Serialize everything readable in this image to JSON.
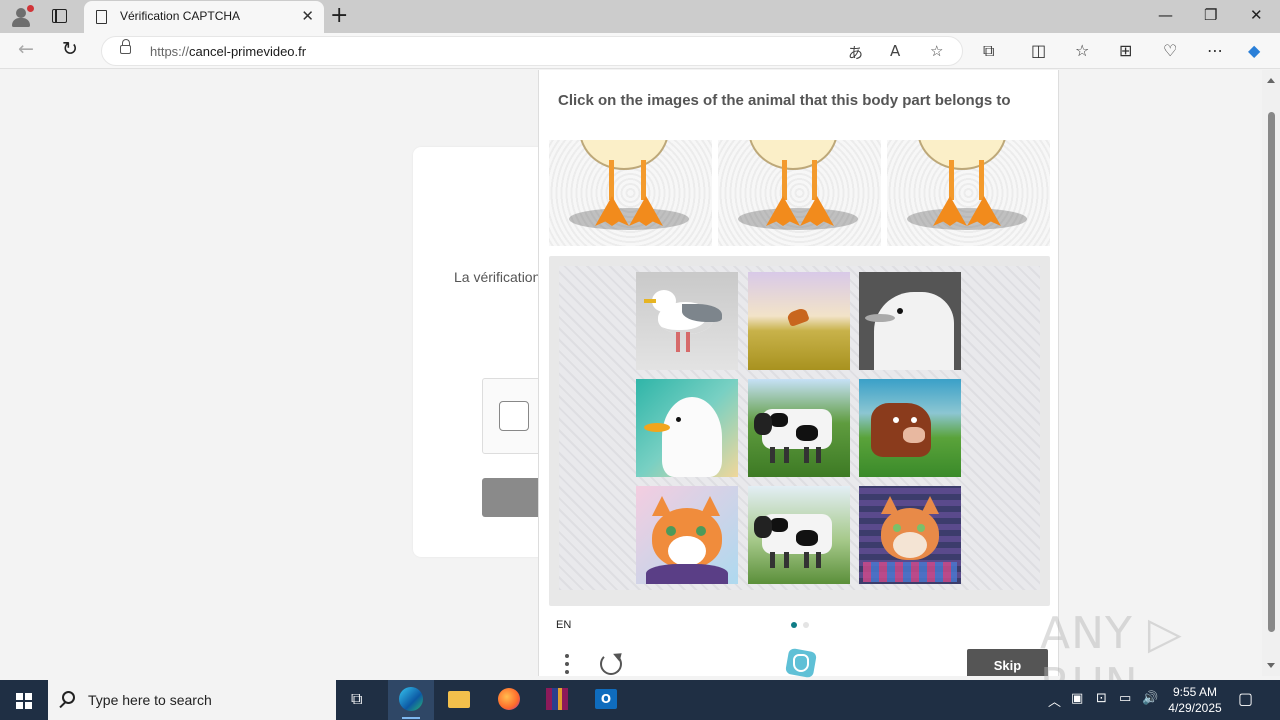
{
  "browser": {
    "tab_title": "Vérification CAPTCHA",
    "url_proto": "https://",
    "url_host": "cancel-primevideo.fr"
  },
  "page": {
    "verification_text": "La vérification"
  },
  "captcha": {
    "instruction": "Click on the images of the animal that this body part belongs to",
    "language": "EN",
    "skip_label": "Skip",
    "page_count": 2,
    "current_page": 1,
    "grid_tiles": [
      {
        "subject": "seagull"
      },
      {
        "subject": "cat in field"
      },
      {
        "subject": "seagull head"
      },
      {
        "subject": "seagull"
      },
      {
        "subject": "cow"
      },
      {
        "subject": "brown cow"
      },
      {
        "subject": "orange cat"
      },
      {
        "subject": "cow"
      },
      {
        "subject": "cat mosaic"
      }
    ],
    "example_images": [
      {
        "subject": "duck feet"
      },
      {
        "subject": "duck feet"
      },
      {
        "subject": "duck feet"
      }
    ]
  },
  "watermark": "ANY ▷ RUN",
  "taskbar": {
    "search_placeholder": "Type here to search",
    "time": "9:55 AM",
    "date": "4/29/2025"
  },
  "colors": {
    "taskbar": "#1f2f44",
    "skip_button": "#555555",
    "active_dot": "#0f7d86"
  }
}
